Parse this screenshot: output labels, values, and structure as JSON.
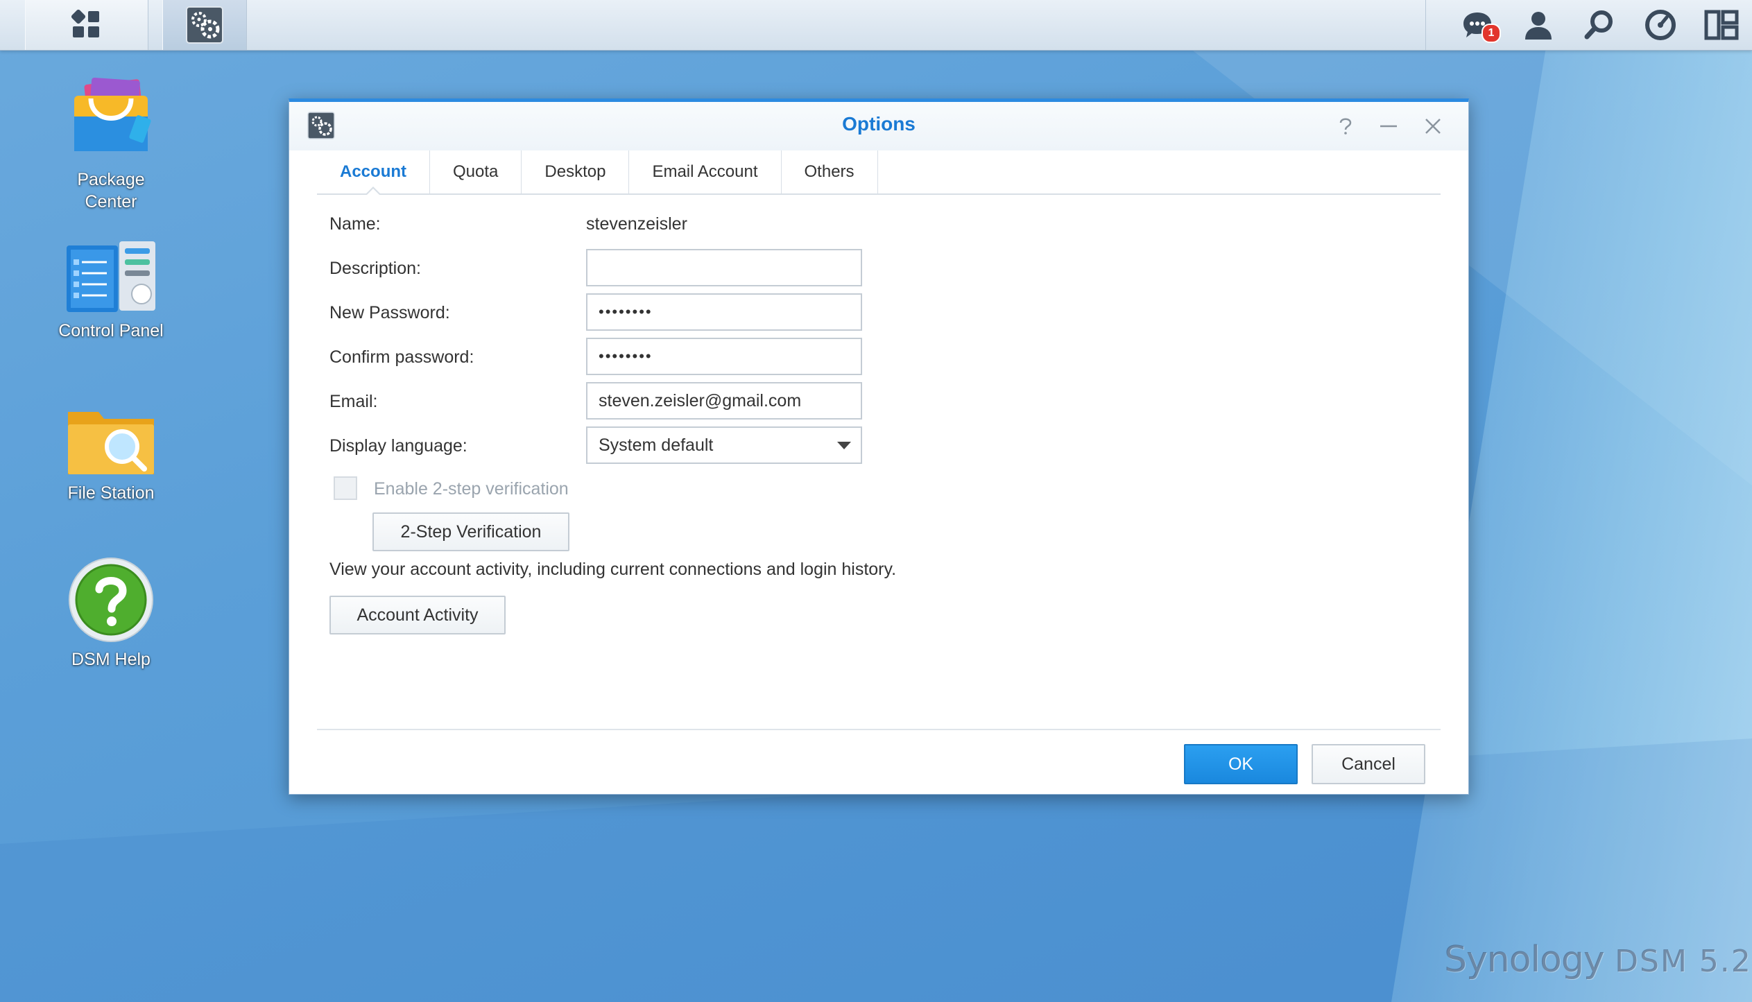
{
  "desktop": {
    "icons": [
      {
        "label_line1": "Package",
        "label_line2": "Center"
      },
      {
        "label_line1": "Control Panel"
      },
      {
        "label_line1": "File Station"
      },
      {
        "label_line1": "DSM Help"
      }
    ]
  },
  "taskbar": {
    "notification_count": "1",
    "icons": [
      "main-menu-icon",
      "options-app-icon",
      "notifications-icon",
      "user-icon",
      "search-icon",
      "resource-monitor-icon",
      "widgets-icon"
    ]
  },
  "dialog": {
    "title": "Options",
    "tabs": [
      "Account",
      "Quota",
      "Desktop",
      "Email Account",
      "Others"
    ],
    "active_tab": "Account",
    "fields": {
      "name_label": "Name:",
      "name_value": "stevenzeisler",
      "description_label": "Description:",
      "description_value": "",
      "new_password_label": "New Password:",
      "new_password_value": "••••••••",
      "confirm_password_label": "Confirm password:",
      "confirm_password_value": "••••••••",
      "email_label": "Email:",
      "email_value": "steven.zeisler@gmail.com",
      "display_language_label": "Display language:",
      "display_language_value": "System default"
    },
    "two_step_checkbox_label": "Enable 2-step verification",
    "two_step_button": "2-Step Verification",
    "activity_text": "View your account activity, including current connections and login history.",
    "activity_button": "Account Activity",
    "ok_button": "OK",
    "cancel_button": "Cancel"
  },
  "watermark": {
    "brand": "Synology",
    "version": "DSM 5.2"
  },
  "colors": {
    "accent": "#1a7ad4",
    "ok_button": "#1a88de",
    "desktop": "#5b9fd8"
  }
}
